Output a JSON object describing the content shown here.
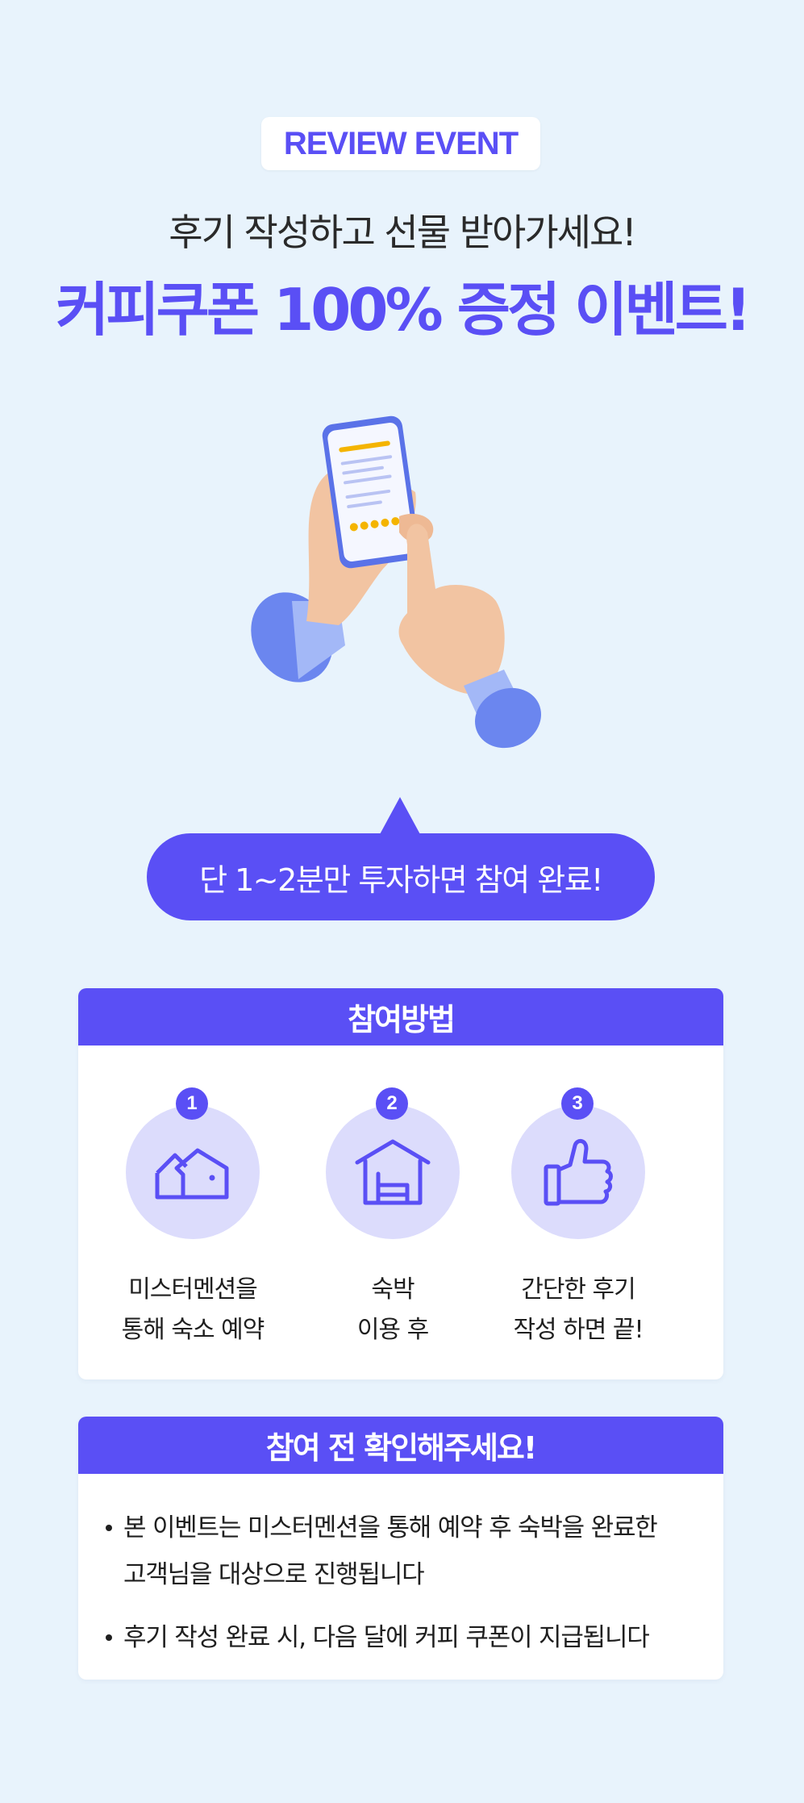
{
  "badge": "REVIEW EVENT",
  "subtitle": "후기 작성하고 선물 받아가세요!",
  "headline": "커피쿠폰 100% 증정 이벤트!",
  "bubble": "단 1~2분만 투자하면 참여 완료!",
  "participation": {
    "title": "참여방법",
    "steps": [
      {
        "num": "1",
        "icon": "houses-icon",
        "line1": "미스터멘션을",
        "line2": "통해 숙소 예약"
      },
      {
        "num": "2",
        "icon": "bed-house-icon",
        "line1": "숙박",
        "line2": "이용 후"
      },
      {
        "num": "3",
        "icon": "thumbs-up-icon",
        "line1": "간단한 후기",
        "line2": "작성 하면 끝!"
      }
    ]
  },
  "notice": {
    "title": "참여 전 확인해주세요!",
    "items": [
      "본 이벤트는 미스터멘션을 통해 예약 후 숙박을 완료한 고객님을 대상으로 진행됩니다",
      "후기 작성 완료 시, 다음 달에 커피 쿠폰이 지급됩니다"
    ]
  },
  "colors": {
    "background": "#e8f3fc",
    "accent": "#5a4ff5",
    "icon_circle": "#dcdcfc",
    "star": "#f4b400"
  }
}
